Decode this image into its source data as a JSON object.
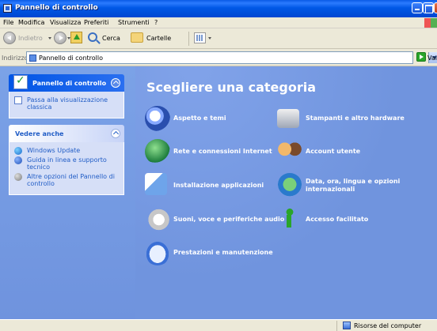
{
  "window": {
    "title": "Pannello di controllo"
  },
  "menu": {
    "items": [
      "File",
      "Modifica",
      "Visualizza",
      "Preferiti",
      "Strumenti",
      "?"
    ]
  },
  "toolbar": {
    "back_label": "Indietro",
    "search_label": "Cerca",
    "folders_label": "Cartelle"
  },
  "address": {
    "label": "Indirizzo",
    "value": "Pannello di controllo",
    "go_label": "Vai"
  },
  "sidebar": {
    "main_panel": {
      "title": "Pannello di controllo",
      "link": "Passa alla visualizzazione classica"
    },
    "see_also": {
      "title": "Vedere anche",
      "links": [
        "Windows Update",
        "Guida in linea e supporto tecnico",
        "Altre opzioni del Pannello di controllo"
      ]
    }
  },
  "main": {
    "heading": "Scegliere una categoria",
    "categories": [
      {
        "label": "Aspetto e temi",
        "icon": "appearance-icon"
      },
      {
        "label": "Stampanti e altro hardware",
        "icon": "printer-icon"
      },
      {
        "label": "Rete e connessioni Internet",
        "icon": "network-icon"
      },
      {
        "label": "Account utente",
        "icon": "users-icon"
      },
      {
        "label": "Installazione applicazioni",
        "icon": "install-icon"
      },
      {
        "label": "Data, ora, lingua e opzioni internazionali",
        "icon": "date-globe-icon"
      },
      {
        "label": "Suoni, voce e periferiche audio",
        "icon": "sound-icon"
      },
      {
        "label": "Accesso facilitato",
        "icon": "accessibility-icon"
      },
      {
        "label": "Prestazioni e manutenzione",
        "icon": "performance-icon"
      }
    ]
  },
  "statusbar": {
    "location": "Risorse del computer"
  }
}
